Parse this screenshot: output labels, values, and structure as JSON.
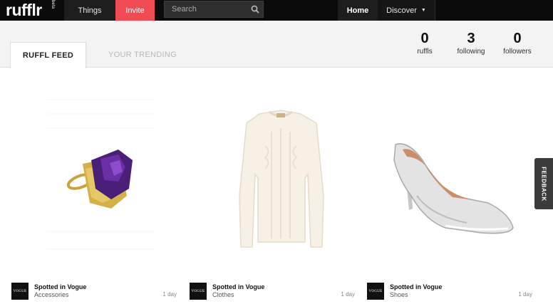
{
  "nav": {
    "logo": "rufflr",
    "logo_tag": "beta",
    "things": "Things",
    "invite": "Invite",
    "search_placeholder": "Search",
    "home": "Home",
    "discover": "Discover"
  },
  "tabs": {
    "feed": "RUFFL FEED",
    "trending": "YOUR TRENDING"
  },
  "stats": [
    {
      "value": "0",
      "label": "ruffls"
    },
    {
      "value": "3",
      "label": "following"
    },
    {
      "value": "0",
      "label": "followers"
    }
  ],
  "feed": [
    {
      "title": "Spotted in Vogue",
      "category": "Accessories",
      "time": "1 day",
      "source": "VOGUE",
      "image": "amethyst-ring"
    },
    {
      "title": "Spotted in Vogue",
      "category": "Clothes",
      "time": "1 day",
      "source": "VOGUE",
      "image": "cream-sweater"
    },
    {
      "title": "Spotted in Vogue",
      "category": "Shoes",
      "time": "1 day",
      "source": "VOGUE",
      "image": "silver-pump"
    }
  ],
  "feedback": "FEEDBACK",
  "colors": {
    "nav_bg": "#0b0b0b",
    "invite_accent": "#f04a52",
    "subbar_bg": "#f3f3f3"
  }
}
